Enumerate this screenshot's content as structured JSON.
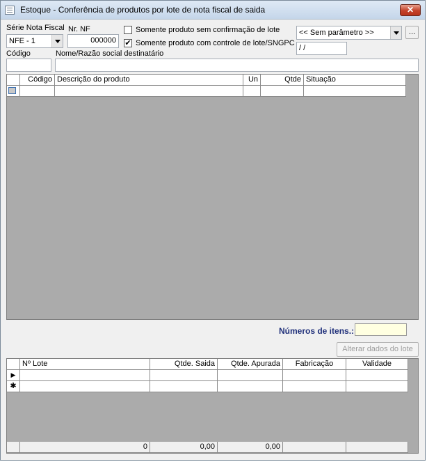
{
  "window": {
    "title": "Estoque - Conferência de produtos por lote de nota fiscal de saida",
    "close_glyph": "✕"
  },
  "filters": {
    "serie_label": "Série Nota Fiscal",
    "serie_value": "NFE - 1",
    "nf_label": "Nr. NF",
    "nf_value": "000000",
    "check1_label": "Somente produto sem confirmação de lote",
    "check1_checked": false,
    "check2_label": "Somente produto com controle de lote/SNGPC",
    "check2_checked": true,
    "check_mark": "✔",
    "param_value": "<< Sem parâmetro >>",
    "ellipsis_label": "...",
    "date_value": " /  /",
    "codigo_label": "Código",
    "codigo_value": "",
    "nome_label": "Nome/Razão social destinatário",
    "nome_value": ""
  },
  "products_grid": {
    "columns": [
      "Código",
      "Descrição do produto",
      "Un",
      "Qtde",
      "Situação"
    ],
    "rows": [
      [
        "",
        "",
        "",
        "",
        ""
      ]
    ]
  },
  "items": {
    "label": "Números de itens.:",
    "value": ""
  },
  "alter_button": "Alterar dados do lote",
  "lot_grid": {
    "columns": [
      "Nº Lote",
      "Qtde. Saida",
      "Qtde. Apurada",
      "Fabricação",
      "Validade"
    ],
    "row_current_marker": "▶",
    "row_new_marker": "✱",
    "totals": [
      "0",
      "0,00",
      "0,00",
      "",
      ""
    ]
  }
}
